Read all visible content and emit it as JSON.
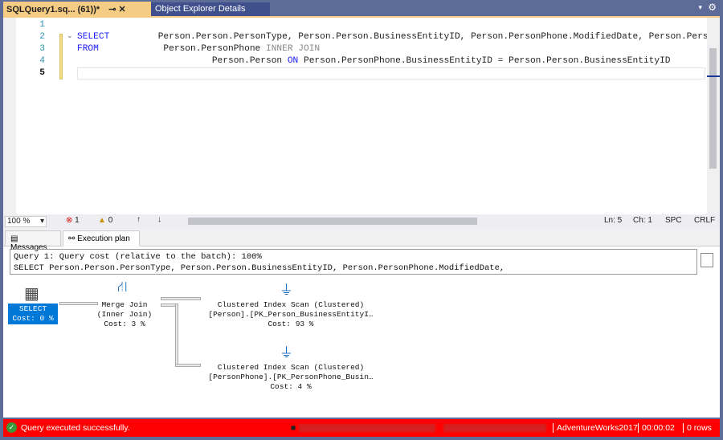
{
  "tabs": {
    "active": "SQLQuery1.sq... (61))*",
    "other": "Object Explorer Details"
  },
  "editor": {
    "line_numbers": [
      "1",
      "2",
      "3",
      "4",
      "5"
    ],
    "lines": [
      {
        "kw": "SELECT",
        "rest": "         Person.Person.PersonType, Person.Person.BusinessEntityID, Person.PersonPhone.ModifiedDate, Person.Pers"
      },
      {
        "kw": "FROM",
        "rest": "            Person.PersonPhone ",
        "gray": "INNER JOIN"
      },
      {
        "pre": "                         Person.Person ",
        "kw": "ON",
        "rest": " Person.PersonPhone.BusinessEntityID = Person.Person.BusinessEntityID"
      }
    ]
  },
  "toolbar": {
    "zoom": "100 %",
    "errors": "1",
    "warnings": "0",
    "ln": "Ln: 5",
    "ch": "Ch: 1",
    "spc": "SPC",
    "crlf": "CRLF"
  },
  "results": {
    "tabs": [
      "Messages",
      "Execution plan"
    ],
    "query_line1": "Query 1: Query cost (relative to the batch): 100%",
    "query_line2": "SELECT Person.Person.PersonType, Person.Person.BusinessEntityID, Person.PersonPhone.ModifiedDate,",
    "nodes": {
      "select": {
        "label": "SELECT",
        "cost": "Cost: 0 %"
      },
      "merge": {
        "label": "Merge Join",
        "sub": "(Inner Join)",
        "cost": "Cost: 3 %"
      },
      "scan1": {
        "label": "Clustered Index Scan (Clustered)",
        "sub": "[Person].[PK_Person_BusinessEntityI…",
        "cost": "Cost: 93 %"
      },
      "scan2": {
        "label": "Clustered Index Scan (Clustered)",
        "sub": "[PersonPhone].[PK_PersonPhone_Busin…",
        "cost": "Cost: 4 %"
      }
    }
  },
  "status": {
    "message": "Query executed successfully.",
    "database": "AdventureWorks2017",
    "time": "00:00:02",
    "rows": "0 rows",
    "color": "#ff0000"
  }
}
